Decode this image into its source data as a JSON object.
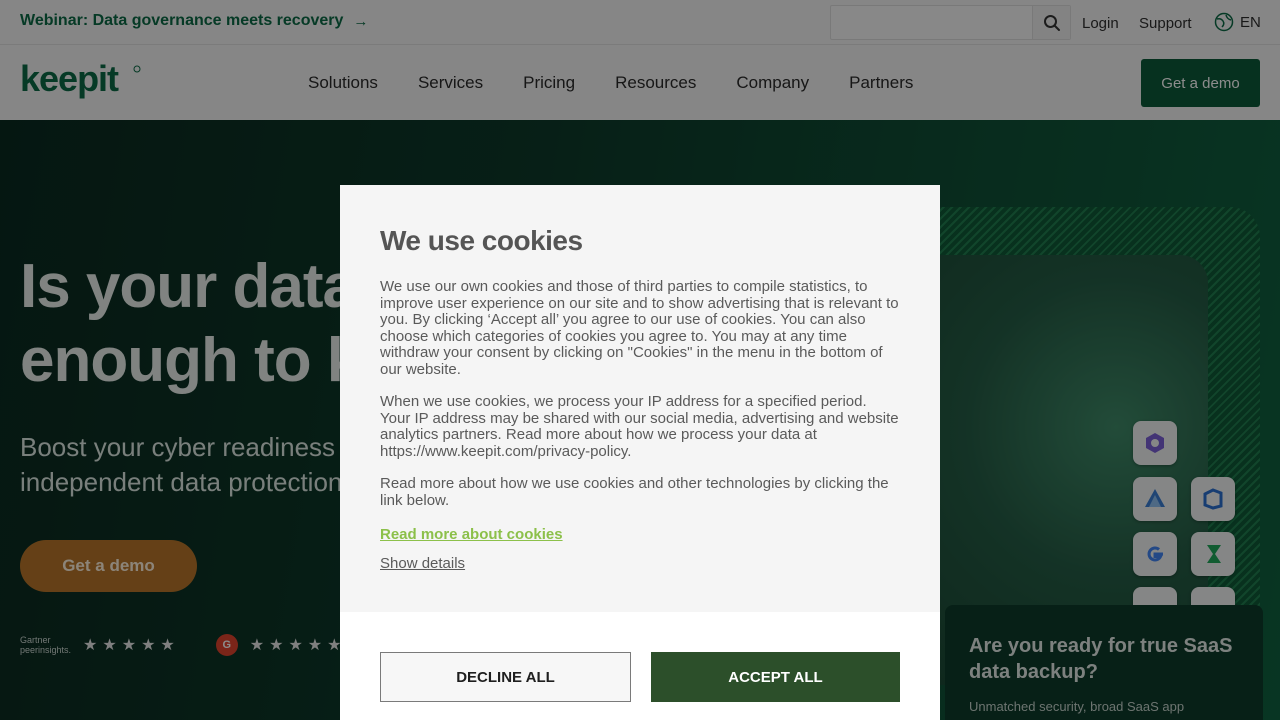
{
  "topbar": {
    "webinar_text": "Webinar: Data governance meets recovery",
    "search_placeholder": "",
    "login": "Login",
    "support": "Support",
    "language": "EN"
  },
  "nav": {
    "logo_text": "keepit",
    "items": [
      "Solutions",
      "Services",
      "Pricing",
      "Resources",
      "Company",
      "Partners"
    ],
    "cta": "Get a demo"
  },
  "hero": {
    "title": "Is your data safe enough to keep?",
    "subtitle": "Boost your cyber readiness with the world's only independent data protection platform.",
    "cta": "Get a demo",
    "peer_label_top": "Gartner",
    "peer_label": "peerinsights.",
    "stars": "★★★★★",
    "saas_title": "Are you ready for true SaaS data backup?",
    "saas_text": "Unmatched security, broad SaaS app"
  },
  "cookie_modal": {
    "title": "We use cookies",
    "paragraphs": [
      "We use our own cookies and those of third parties to compile statistics, to improve user experience on our site and to show advertising that is relevant to you. By clicking ‘Accept all’ you agree to our use of cookies. You can also choose which categories of cookies you agree to. You may at any time withdraw your consent by clicking on \"Cookies\" in the menu in the bottom of our website.",
      "When we use cookies, we process your IP address for a specified period. Your IP address may be shared with our social media, advertising and website analytics partners. Read more about how we process your data at https://www.keepit.com/privacy-policy.",
      "Read more about how we use cookies and other technologies by clicking the link below."
    ],
    "read_more": "Read more about cookies",
    "show_details": "Show details",
    "decline": "DECLINE ALL",
    "accept": "ACCEPT ALL"
  },
  "colors": {
    "brand_green": "#0b5a3a",
    "accept_green": "#2c4f2a",
    "link_green": "#8cc04a",
    "cta_orange": "#b8762a"
  }
}
